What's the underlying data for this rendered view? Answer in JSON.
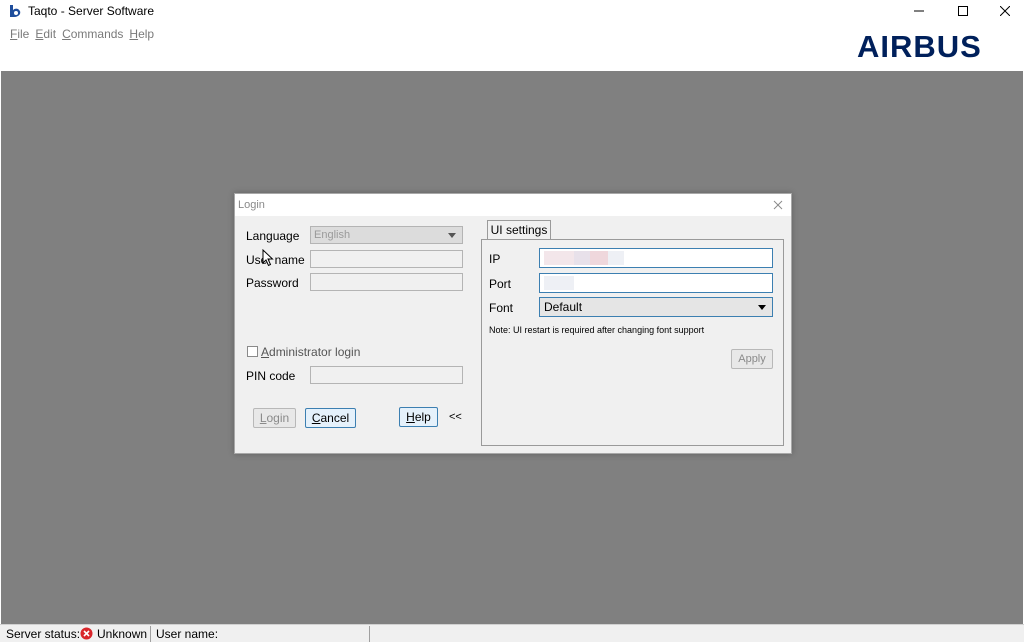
{
  "window": {
    "title": "Taqto - Server Software",
    "brand": "AIRBUS"
  },
  "menu": [
    {
      "label": "File",
      "mnemonic": "F",
      "rest": "ile"
    },
    {
      "label": "Edit",
      "mnemonic": "E",
      "rest": "dit"
    },
    {
      "label": "Commands",
      "mnemonic": "C",
      "rest": "ommands"
    },
    {
      "label": "Help",
      "mnemonic": "H",
      "rest": "elp"
    }
  ],
  "login_dialog": {
    "title": "Login",
    "language_label": "Language",
    "language_value": "English",
    "username_label": "User name",
    "username_value": "",
    "password_label": "Password",
    "password_value": "",
    "admin_login_label": "Administrator login",
    "admin_login_mnemonic": "A",
    "admin_login_rest": "dministrator login",
    "admin_login_checked": false,
    "pin_label": "PIN code",
    "pin_value": "",
    "login_button": {
      "label": "Login",
      "mnemonic": "L",
      "rest": "ogin"
    },
    "cancel_button": {
      "label": "Cancel",
      "mnemonic": "C",
      "rest": "ancel"
    },
    "help_button": {
      "label": "Help",
      "mnemonic": "H",
      "rest": "elp"
    },
    "collapse_label": "<<"
  },
  "ui_settings": {
    "tab_label": "UI settings",
    "ip_label": "IP",
    "port_label": "Port",
    "font_label": "Font",
    "font_value": "Default",
    "note": "Note: UI restart is required after changing font support",
    "apply_button": "Apply"
  },
  "status_bar": {
    "server_status_label": "Server status:",
    "server_status_value": "Unknown",
    "user_name_label": "User name:",
    "user_name_value": ""
  },
  "colors": {
    "brand": "#00205b",
    "desktop": "#808080",
    "focus_border": "#3c7fb1",
    "error": "#d9262b"
  }
}
